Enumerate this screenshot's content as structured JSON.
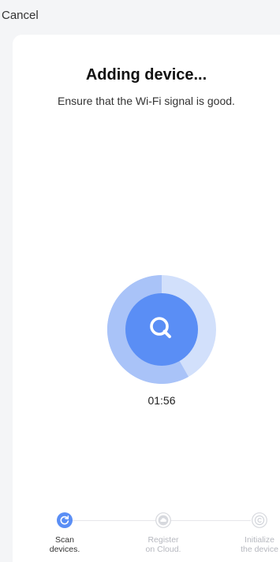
{
  "header": {
    "cancel_label": "Cancel"
  },
  "main": {
    "title": "Adding device...",
    "subtitle": "Ensure that the Wi-Fi signal is good.",
    "timer": "01:56",
    "progress_icon": "search-icon"
  },
  "steps": [
    {
      "label_line1": "Scan",
      "label_line2": "devices.",
      "state": "active",
      "icon": "refresh-icon"
    },
    {
      "label_line1": "Register",
      "label_line2": "on Cloud.",
      "state": "pending",
      "icon": "cloud-icon"
    },
    {
      "label_line1": "Initialize",
      "label_line2": "the device",
      "state": "pending",
      "icon": "copyright-icon"
    }
  ],
  "colors": {
    "accent": "#5a8ef5",
    "accent_light": "#a9c3f8",
    "accent_ring": "#d2e0fb",
    "inactive": "#d7d9de",
    "background": "#f4f5f7"
  }
}
